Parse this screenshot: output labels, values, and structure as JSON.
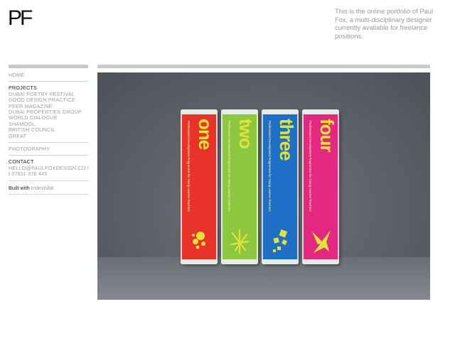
{
  "logo": "PF",
  "intro": "This is the online portfolio of Paul Fox, a multi-disciplinary designer currently available for freelance positions.",
  "nav": {
    "home": "HOME",
    "projects_heading": "PROJECTS",
    "projects": [
      "DUBAI POETRY FESTIVAL",
      "GOOD DESIGN PRACTICE",
      "PEER MAGAZINE",
      "DUBAI PROPERTIES GROUP",
      "WORLD DIALOGUE",
      "SHAMOOL",
      "BRITISH COUNCIL",
      "GREAT"
    ],
    "photography": "PHOTOGRAPHY",
    "contact_heading": "CONTACT",
    "email": "HELLO@PAULFOXDESIGN.CO.UK",
    "phone": "t 07811 376 445",
    "built_with_label": "Built with",
    "built_with_link": "Indexhibit"
  },
  "photo": {
    "books": [
      {
        "title": "one",
        "color": "#e8332a",
        "subtitle": "Professional Development Programme for Young Learner Teachers"
      },
      {
        "title": "two",
        "color": "#8dc63f",
        "subtitle": "Professional Development Programme for Young Learner Teachers"
      },
      {
        "title": "three",
        "color": "#1f6fc7",
        "subtitle": "Professional Development Programme for Young Learner Teachers"
      },
      {
        "title": "four",
        "color": "#e2297f",
        "subtitle": "Professional Development Programme for Young Learner Teachers"
      }
    ],
    "accent_color": "#e2e23a"
  }
}
